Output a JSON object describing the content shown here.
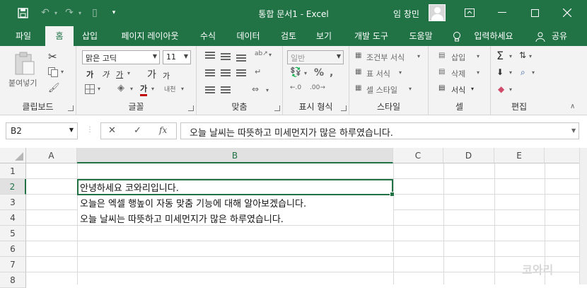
{
  "title_bar": {
    "title": "통합 문서1  -  Excel",
    "user": "임 창민"
  },
  "tabs": [
    "파일",
    "홈",
    "삽입",
    "페이지 레이아웃",
    "수식",
    "데이터",
    "검토",
    "보기",
    "개발 도구",
    "도움말",
    "입력하세요",
    "공유"
  ],
  "ribbon": {
    "clipboard": {
      "paste": "붙여넣기",
      "label": "클립보드"
    },
    "font": {
      "name": "맑은 고딕",
      "size": "11",
      "bold": "가",
      "italic": "가",
      "underline": "가",
      "grow": "가",
      "shrink": "가",
      "font_color": "가",
      "phonetic": "내천",
      "label": "글꼴"
    },
    "alignment": {
      "label": "맞춤"
    },
    "number": {
      "format": "일반",
      "label": "표시 형식"
    },
    "styles": {
      "conditional": "조건부 서식",
      "table": "표 서식",
      "cell_styles": "셀 스타일",
      "label": "스타일"
    },
    "cells": {
      "insert": "삽입",
      "delete": "삭제",
      "format": "서식",
      "label": "셀"
    },
    "editing": {
      "label": "편집"
    }
  },
  "formula_bar": {
    "name_box": "B2",
    "fx": "fx",
    "value": "오늘 날씨는 따뜻하고 미세먼지가 많은 하루였습니다."
  },
  "columns": [
    "A",
    "B",
    "C",
    "D",
    "E"
  ],
  "rows": [
    "1",
    "2",
    "3",
    "4",
    "5",
    "6",
    "7",
    "8"
  ],
  "cells": {
    "B2": "안녕하세요 코와리입니다.",
    "B3": "오늘은 엑셀 행높이 자동 맞춤 기능에 대해 알아보겠습니다.",
    "B4": "오늘 날씨는 따뜻하고 미세먼지가 많은 하루였습니다."
  },
  "watermark": "코와리",
  "colors": {
    "accent": "#217346"
  }
}
